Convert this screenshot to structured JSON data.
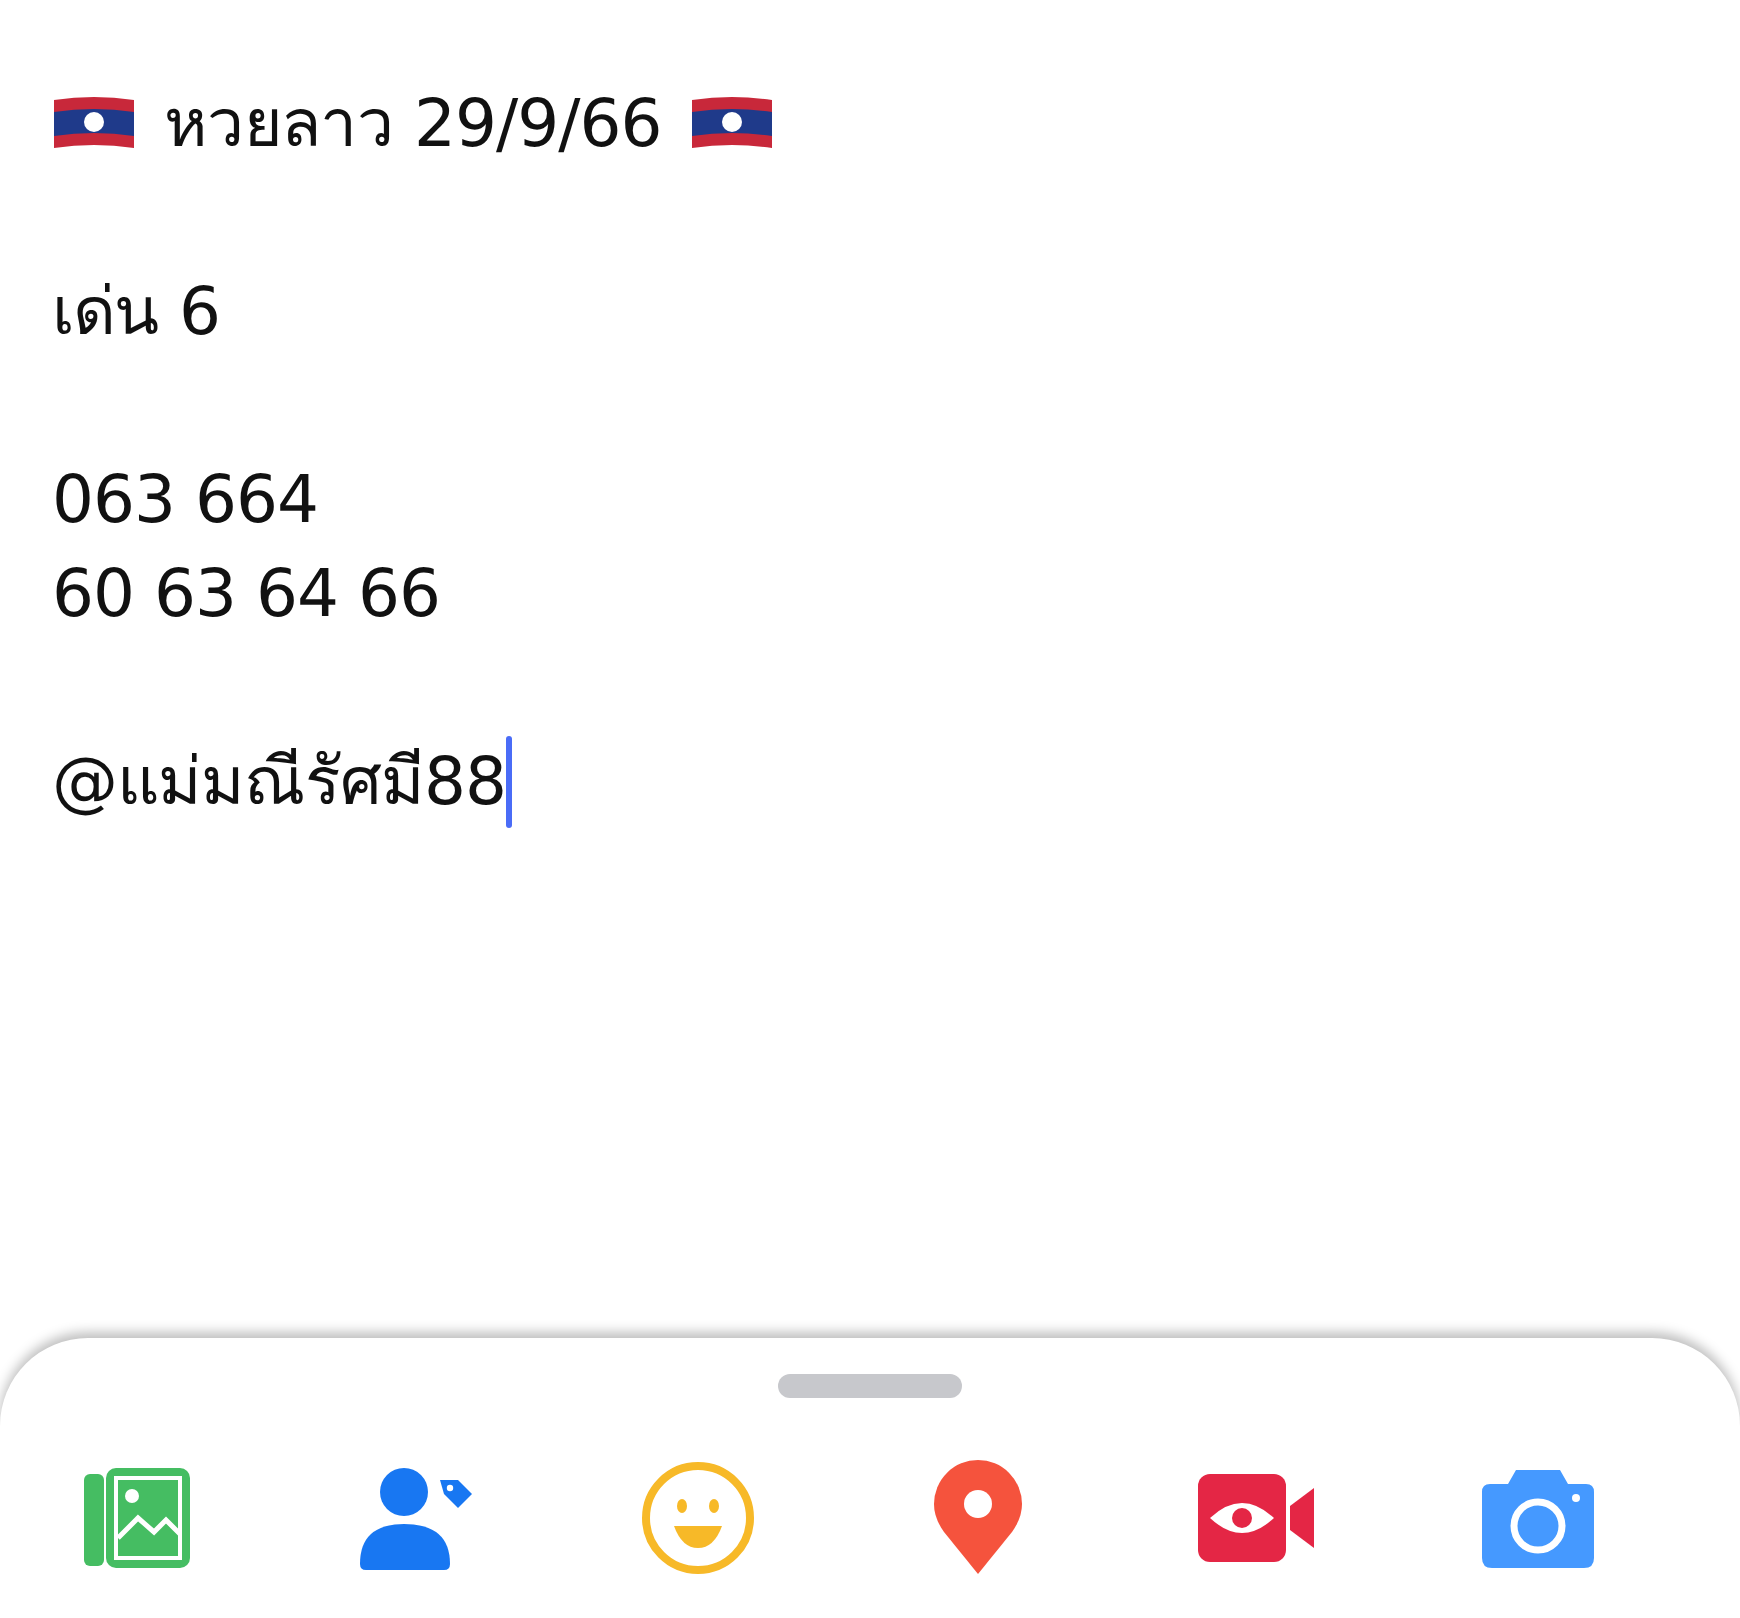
{
  "post": {
    "title": "หวยลาว 29/9/66",
    "paragraphs": [
      [
        "เด่น 6"
      ],
      [
        "063 664",
        "60 63 64 66"
      ],
      [
        "@แม่มณีรัศมี88"
      ]
    ],
    "cursor_visible": true
  }
}
